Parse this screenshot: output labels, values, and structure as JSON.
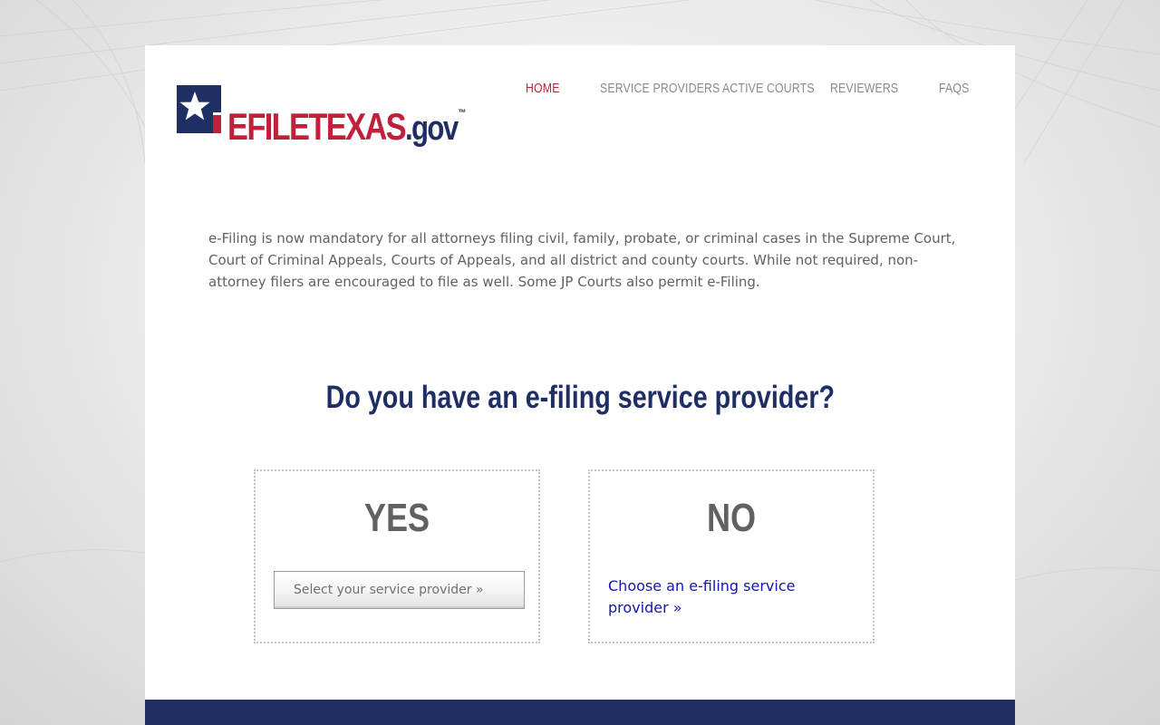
{
  "header": {
    "logo": {
      "part1": "EFILE",
      "part2": "TEXAS",
      "part3": ".gov",
      "trademark": "™"
    },
    "nav": [
      {
        "label": "HOME",
        "active": true
      },
      {
        "label": "SERVICE PROVIDERS",
        "active": false
      },
      {
        "label": "ACTIVE COURTS",
        "active": false
      },
      {
        "label": "REVIEWERS",
        "active": false
      },
      {
        "label": "FAQS",
        "active": false
      }
    ]
  },
  "main": {
    "intro": "e-Filing is now mandatory for all attorneys filing civil, family, probate, or criminal cases in the Supreme Court, Court of Criminal Appeals, Courts of Appeals, and all district and county courts. While not required, non-attorney filers are encouraged to file as well. Some JP Courts also permit e-Filing.",
    "question": "Do you have an e-filing service provider?",
    "yes": {
      "title": "YES",
      "button_label": "Select your service provider »"
    },
    "no": {
      "title": "NO",
      "link_label": "Choose an e-filing service provider »"
    }
  },
  "colors": {
    "navy": "#1f2f63",
    "red": "#c0213a",
    "nav_inactive": "#8a8a8a",
    "link": "#1414b4",
    "body_text": "#616161"
  },
  "icons": {
    "logo_star": "star-icon"
  }
}
